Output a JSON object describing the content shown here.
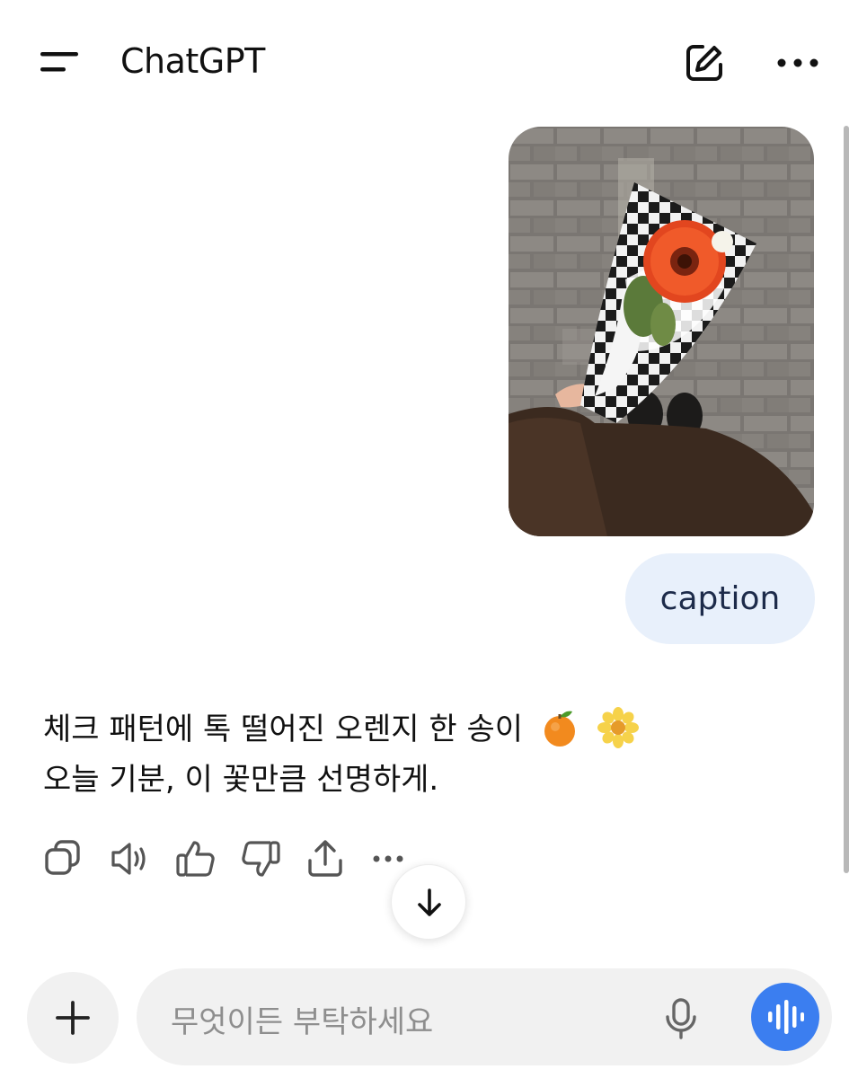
{
  "header": {
    "title": "ChatGPT",
    "menu_icon": "menu-icon",
    "new_chat_icon": "new-chat-icon",
    "more_icon": "more-icon"
  },
  "conversation": {
    "user_image": {
      "subject": "orange-gerbera-bouquet-photo"
    },
    "user_message": "caption",
    "assistant_message": {
      "line1": "체크 패턴에 톡 떨어진 오렌지 한 송이",
      "line1_emojis": [
        "tangerine-emoji",
        "blossom-emoji"
      ],
      "line2": "오늘 기분, 이 꽃만큼 선명하게."
    },
    "actions": [
      {
        "icon": "copy-icon"
      },
      {
        "icon": "read-aloud-icon"
      },
      {
        "icon": "thumbs-up-icon"
      },
      {
        "icon": "thumbs-down-icon"
      },
      {
        "icon": "share-icon"
      },
      {
        "icon": "more-icon"
      }
    ]
  },
  "scroll_down": {
    "icon": "arrow-down-icon"
  },
  "composer": {
    "plus_icon": "plus-icon",
    "placeholder": "무엇이든 부탁하세요",
    "mic_icon": "mic-icon",
    "voice_icon": "voice-waveform-icon"
  },
  "colors": {
    "user_bubble_bg": "#e8f0fb",
    "voice_button": "#3b7ef0",
    "input_bg": "#f1f1f1"
  }
}
